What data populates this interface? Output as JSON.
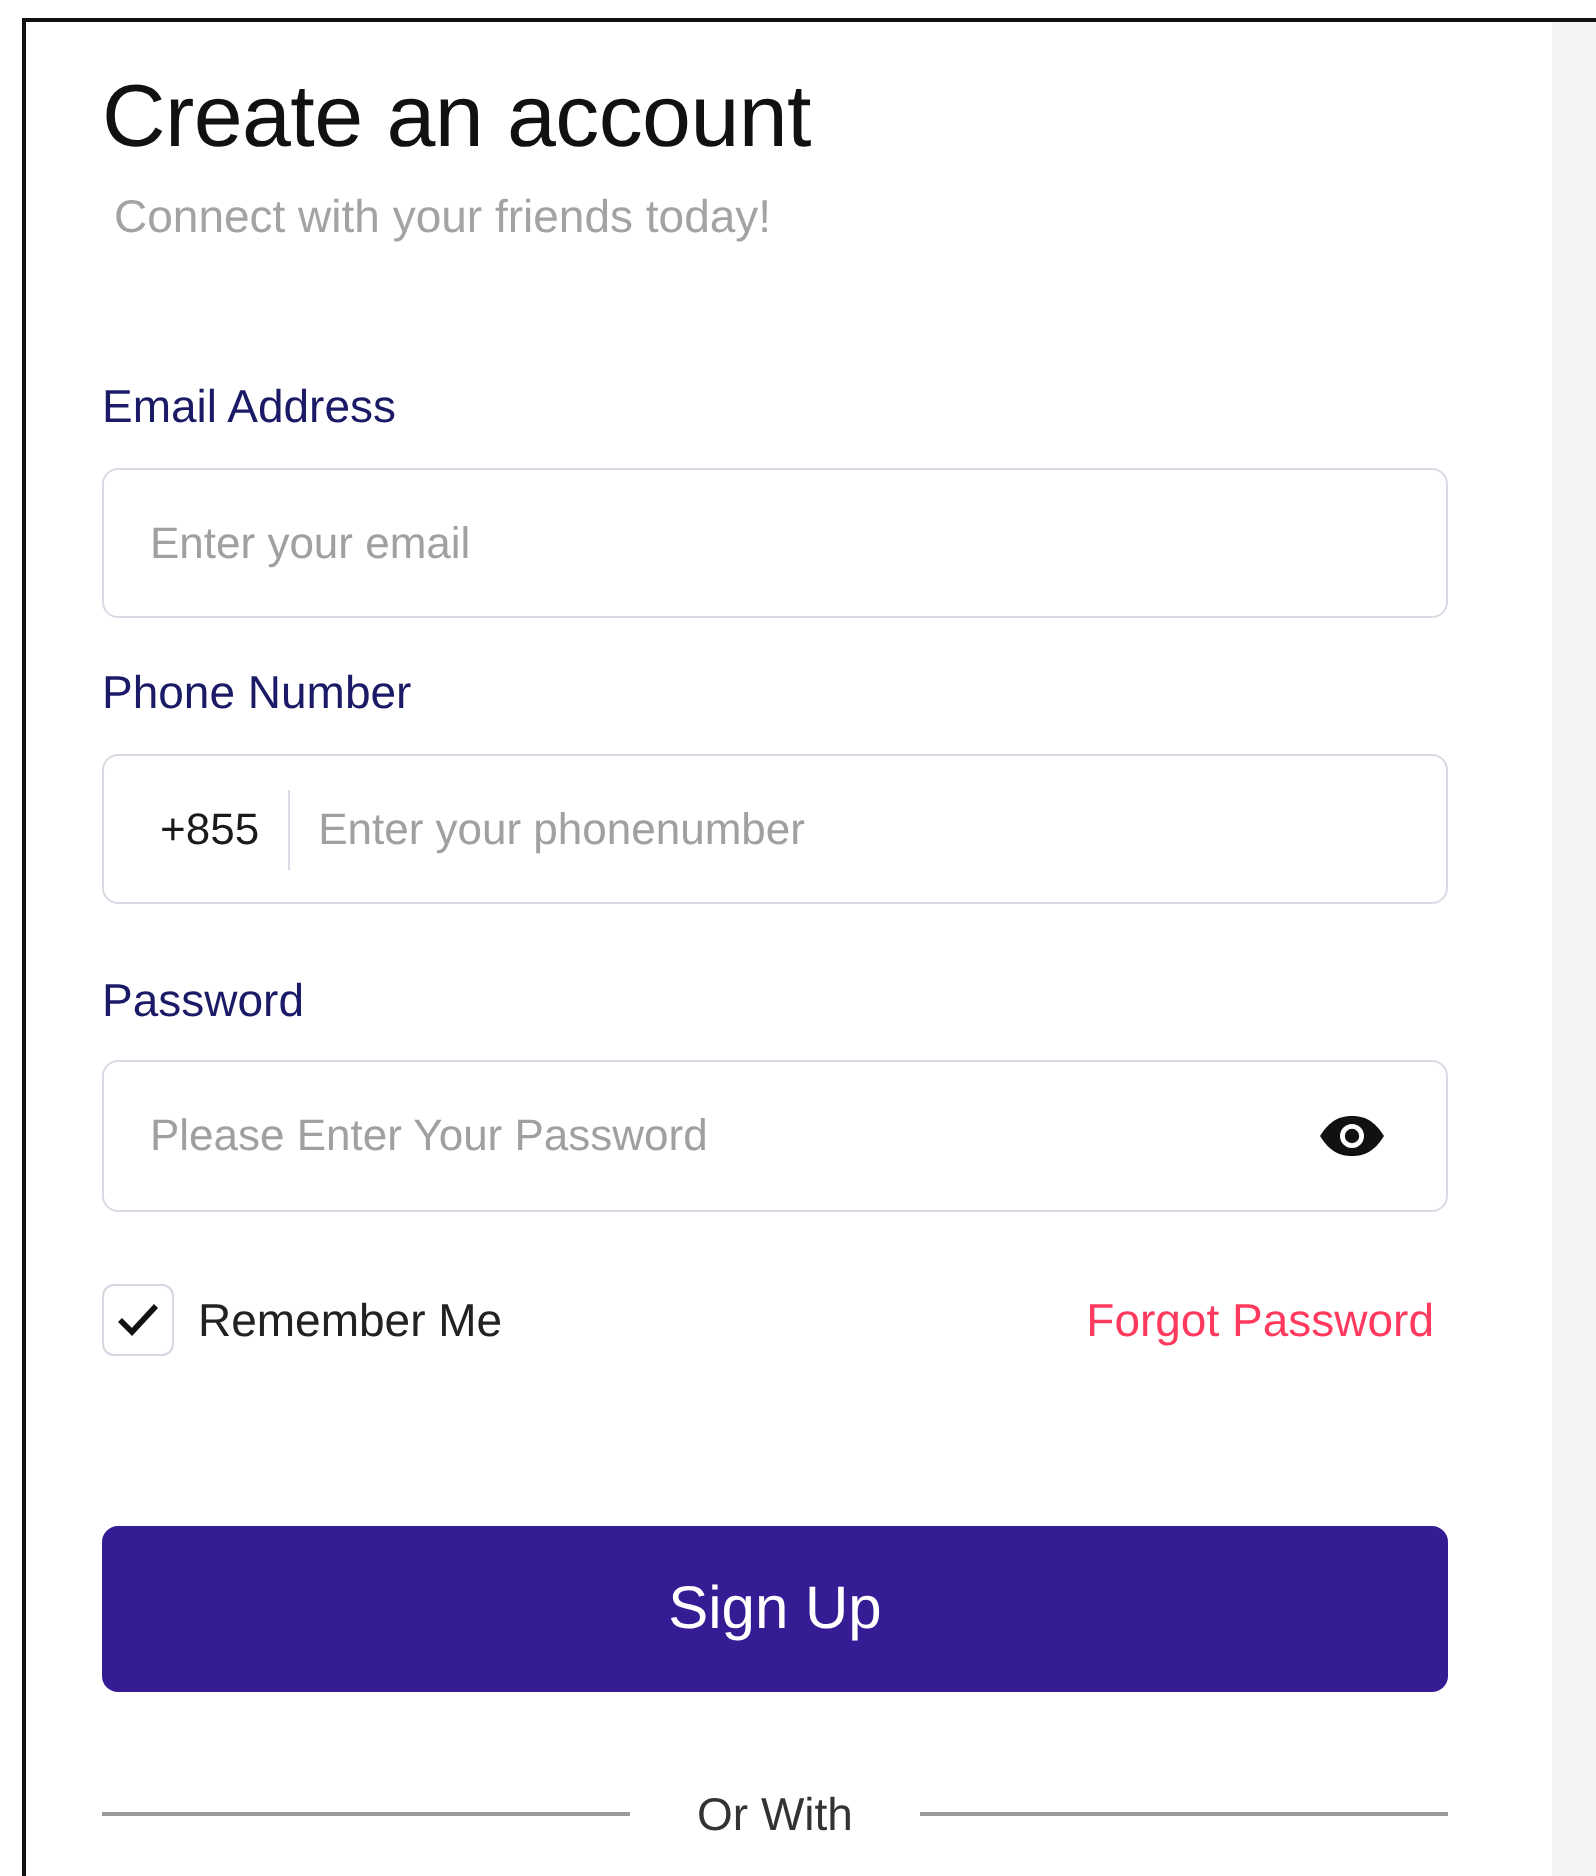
{
  "title": "Create an account",
  "subtitle": "Connect with your friends today!",
  "fields": [
    {
      "kind": "email",
      "label": "Email Address",
      "placeholder": "Enter your email"
    },
    {
      "kind": "phone",
      "label": "Phone Number",
      "prefix": "+855",
      "placeholder": "Enter your phonenumber"
    },
    {
      "kind": "password",
      "label": "Password",
      "placeholder": "Please Enter Your Password"
    }
  ],
  "remember": {
    "label": "Remember Me",
    "checked": true
  },
  "forgot_link": "Forgot Password",
  "submit_button": "Sign Up",
  "divider_text": "Or With"
}
